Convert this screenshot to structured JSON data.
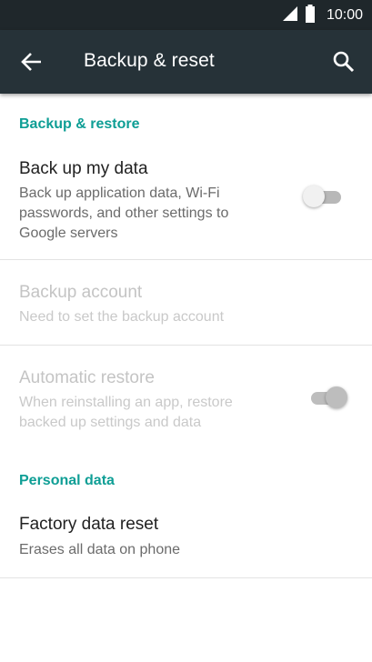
{
  "status_bar": {
    "time": "10:00"
  },
  "app_bar": {
    "title": "Backup & reset"
  },
  "sections": {
    "backup_restore": {
      "header": "Backup & restore"
    },
    "personal_data": {
      "header": "Personal data"
    }
  },
  "items": {
    "backup_data": {
      "title": "Back up my data",
      "summary": "Back up application data, Wi-Fi passwords, and other settings to Google servers",
      "toggle_on": false
    },
    "backup_account": {
      "title": "Backup account",
      "summary": "Need to set the backup account"
    },
    "automatic_restore": {
      "title": "Automatic restore",
      "summary": "When reinstalling an app, restore backed up settings and data",
      "toggle_on": true
    },
    "factory_reset": {
      "title": "Factory data reset",
      "summary": "Erases all data on phone"
    }
  },
  "colors": {
    "status_bar": "#1f272b",
    "app_bar": "#263238",
    "accent": "#0e9e95"
  },
  "icons": [
    "signal-icon",
    "battery-icon",
    "back-arrow-icon",
    "search-icon"
  ]
}
